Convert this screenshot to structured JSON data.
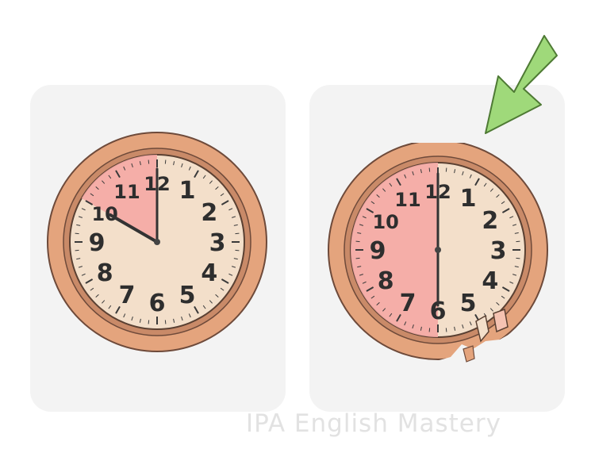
{
  "illustration": {
    "clock_numerals": [
      "12",
      "1",
      "2",
      "3",
      "4",
      "5",
      "6",
      "7",
      "8",
      "9",
      "10",
      "11"
    ],
    "left_clock": {
      "shown_time": "10:00",
      "highlight": "sector from 10 to 12"
    },
    "right_clock": {
      "shown_time": "6:00",
      "highlight": "left half from 6 to 12",
      "state": "torn at bottom-right"
    },
    "pointer": {
      "icon": "arrow-down-left-icon",
      "color": "#9fd97a"
    },
    "colors": {
      "panel": "#f3f3f3",
      "rim": "#e4a47d",
      "face": "#f3dfca",
      "highlight": "#f5a9a4"
    }
  },
  "watermark": "IPA English Mastery"
}
